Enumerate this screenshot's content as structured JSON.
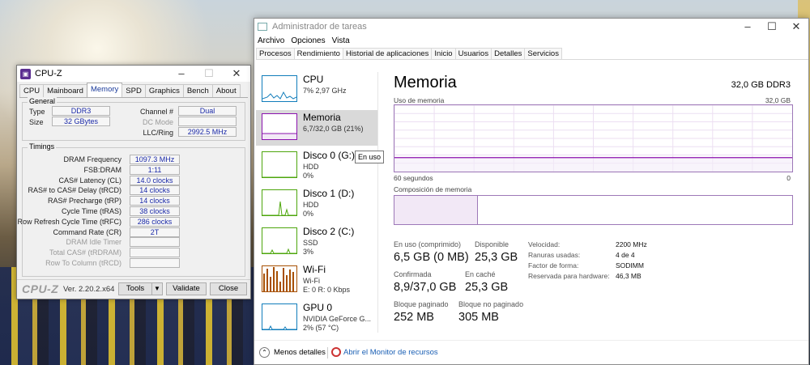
{
  "cpuz": {
    "title": "CPU-Z",
    "tabs": [
      "CPU",
      "Mainboard",
      "Memory",
      "SPD",
      "Graphics",
      "Bench",
      "About"
    ],
    "active_tab": "Memory",
    "general_label": "General",
    "general": {
      "type_label": "Type",
      "type_value": "DDR3",
      "size_label": "Size",
      "size_value": "32 GBytes",
      "channel_label": "Channel #",
      "channel_value": "Dual",
      "dc_mode_label": "DC Mode",
      "llc_label": "LLC/Ring",
      "llc_value": "2992.5 MHz"
    },
    "timings_label": "Timings",
    "timings": [
      {
        "label": "DRAM Frequency",
        "value": "1097.3 MHz"
      },
      {
        "label": "FSB:DRAM",
        "value": "1:11"
      },
      {
        "label": "CAS# Latency (CL)",
        "value": "14.0 clocks"
      },
      {
        "label": "RAS# to CAS# Delay (tRCD)",
        "value": "14 clocks"
      },
      {
        "label": "RAS# Precharge (tRP)",
        "value": "14 clocks"
      },
      {
        "label": "Cycle Time (tRAS)",
        "value": "38 clocks"
      },
      {
        "label": "Row Refresh Cycle Time (tRFC)",
        "value": "286 clocks"
      },
      {
        "label": "Command Rate (CR)",
        "value": "2T"
      },
      {
        "label": "DRAM Idle Timer",
        "value": ""
      },
      {
        "label": "Total CAS# (tRDRAM)",
        "value": ""
      },
      {
        "label": "Row To Column (tRCD)",
        "value": ""
      }
    ],
    "brand": "CPU-Z",
    "version": "Ver. 2.20.2.x64",
    "tools_label": "Tools",
    "validate_label": "Validate",
    "close_label": "Close"
  },
  "taskmgr": {
    "title": "Administrador de tareas",
    "menu": [
      "Archivo",
      "Opciones",
      "Vista"
    ],
    "tabs": [
      "Procesos",
      "Rendimiento",
      "Historial de aplicaciones",
      "Inicio",
      "Usuarios",
      "Detalles",
      "Servicios"
    ],
    "active_tab": "Rendimiento",
    "resources": [
      {
        "name": "CPU",
        "line1": "7% 2,97 GHz",
        "line2": "",
        "color": "#117dbb"
      },
      {
        "name": "Memoria",
        "line1": "6,7/32,0 GB (21%)",
        "line2": "",
        "color": "#8b12ae"
      },
      {
        "name": "Disco 0 (G:)",
        "line1": "HDD",
        "line2": "0%",
        "color": "#4da60c"
      },
      {
        "name": "Disco 1 (D:)",
        "line1": "HDD",
        "line2": "0%",
        "color": "#4da60c"
      },
      {
        "name": "Disco 2 (C:)",
        "line1": "SSD",
        "line2": "3%",
        "color": "#4da60c"
      },
      {
        "name": "Wi-Fi",
        "line1": "Wi-Fi",
        "line2": "E: 0 R: 0 Kbps",
        "color": "#a74f01"
      },
      {
        "name": "GPU 0",
        "line1": "NVIDIA GeForce G...",
        "line2": "2% (57 °C)",
        "color": "#117dbb"
      }
    ],
    "tooltip": "En uso",
    "panel": {
      "title": "Memoria",
      "capacity": "32,0 GB DDR3",
      "usage_label": "Uso de memoria",
      "usage_max": "32,0 GB",
      "time_label": "60 segundos",
      "time_zero": "0",
      "usage_fraction": 0.21,
      "composition_label": "Composición de memoria",
      "composition_used_fraction": 0.21,
      "stats": {
        "in_use_label": "En uso (comprimido)",
        "in_use_value": "6,5 GB (0 MB)",
        "available_label": "Disponible",
        "available_value": "25,3 GB",
        "committed_label": "Confirmada",
        "committed_value": "8,9/37,0 GB",
        "cached_label": "En caché",
        "cached_value": "25,3 GB",
        "paged_label": "Bloque paginado",
        "paged_value": "252 MB",
        "nonpaged_label": "Bloque no paginado",
        "nonpaged_value": "305 MB"
      },
      "details": [
        {
          "key": "Velocidad:",
          "value": "2200 MHz"
        },
        {
          "key": "Ranuras usadas:",
          "value": "4 de 4"
        },
        {
          "key": "Factor de forma:",
          "value": "SODIMM"
        },
        {
          "key": "Reservada para hardware:",
          "value": "46,3 MB"
        }
      ]
    },
    "footer": {
      "less_details": "Menos detalles",
      "resource_monitor": "Abrir el Monitor de recursos"
    }
  }
}
